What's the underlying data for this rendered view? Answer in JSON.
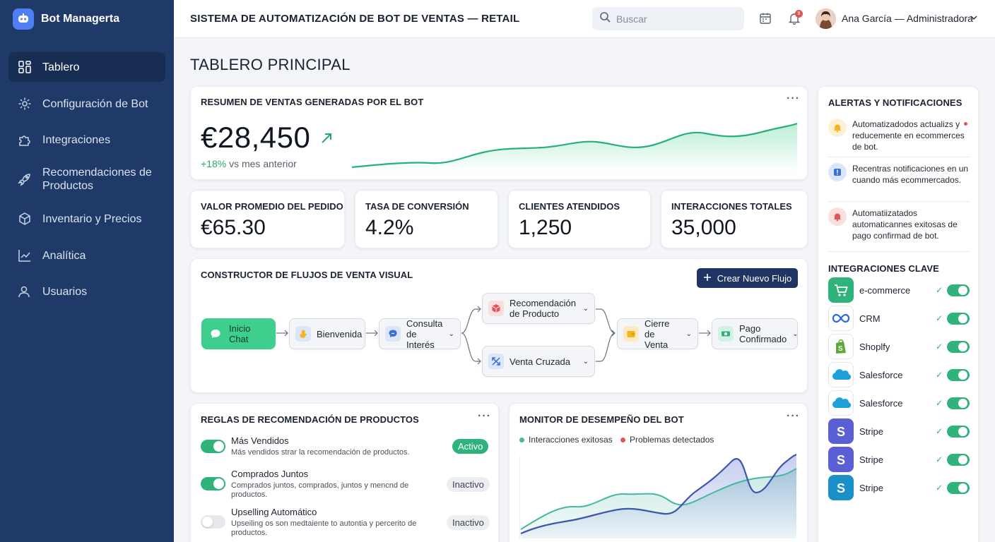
{
  "app": {
    "name": "Bot Managerta"
  },
  "sidebar": {
    "items": [
      {
        "label": "Tablero",
        "icon": "dashboard-grid-icon",
        "active": true
      },
      {
        "label": "Configuración de Bot",
        "icon": "gear-icon"
      },
      {
        "label": "Integraciones",
        "icon": "puzzle-icon"
      },
      {
        "label": "Recomendaciones de Productos",
        "icon": "rocket-icon"
      },
      {
        "label": "Inventario y Precios",
        "icon": "box-icon"
      },
      {
        "label": "Analítica",
        "icon": "line-chart-icon"
      },
      {
        "label": "Usuarios",
        "icon": "users-icon"
      }
    ]
  },
  "header": {
    "title": "SISTEMA DE AUTOMATIZACIÓN DE BOT DE VENTAS — RETAIL",
    "search_placeholder": "Buscar",
    "notification_count": "9",
    "user": "Ana García — Administradora"
  },
  "page": {
    "title": "TABLERO PRINCIPAL"
  },
  "sales": {
    "title": "RESUMEN DE VENTAS GENERADAS POR EL BOT",
    "value": "€28,450",
    "delta_pct": "+18%",
    "delta_text": " vs mes anterior",
    "trend_color": "#27a86a"
  },
  "kpis": [
    {
      "label": "VALOR PROMEDIO DEL PEDIDO",
      "value": "€65.30"
    },
    {
      "label": "TASA DE CONVERSIÓN",
      "value": "4.2%"
    },
    {
      "label": "CLIENTES ATENDIDOS",
      "value": "1,250"
    },
    {
      "label": "INTERACCIONES TOTALES",
      "value": "35,000"
    }
  ],
  "flow": {
    "title": "CONSTRUCTOR DE FLUJOS DE VENTA VISUAL",
    "new_button": "Crear Nuevo Flujo",
    "nodes": [
      {
        "label": "Inicio Chat",
        "icon": "chat-bubble-icon"
      },
      {
        "label": "Bienvenida",
        "icon": "wave-hand-icon"
      },
      {
        "label": "Consulta de Interés",
        "icon": "question-bubble-icon"
      },
      {
        "label": "Recomendación de Producto",
        "icon": "product-box-icon"
      },
      {
        "label": "Venta Cruzada",
        "icon": "cross-arrows-icon"
      },
      {
        "label": "Cierre de Venta",
        "icon": "wallet-icon"
      },
      {
        "label": "Pago Confirmado",
        "icon": "money-icon"
      }
    ]
  },
  "rules": {
    "title": "REGLAS DE RECOMENDACIÓN DE PRODUCTOS",
    "items": [
      {
        "name": "Más Vendidos",
        "desc": "Más vendidos strar la recomendación de productos.",
        "status": "Activo",
        "on": true
      },
      {
        "name": "Comprados Juntos",
        "desc": "Comprados juntos, comprados, juntos y mencnd de productos.",
        "status": "Inactivo",
        "on": true
      },
      {
        "name": "Upselling Automático",
        "desc": "Upseiling os son medtaiente to autontia y percerito de productos.",
        "status": "Inactivo",
        "on": false
      }
    ]
  },
  "monitor": {
    "title": "MONITOR DE DESEMPEÑO DEL BOT",
    "legend": [
      {
        "label": "Interacciones exitosas",
        "color": "#45b8a0"
      },
      {
        "label": "Problemas detectados",
        "color": "#e25555"
      }
    ]
  },
  "alerts": {
    "title": "ALERTAS Y NOTIFICACIONES",
    "items": [
      {
        "text": "Automatizadodos actualizs y reducemente en ecommerces de bot.",
        "icon": "bell-icon",
        "color": "#f4b41a"
      },
      {
        "text": "Recentras notificaciones en un cuando más ecommercados.",
        "icon": "info-icon",
        "color": "#3a6fd8"
      },
      {
        "text": "Automatiizatados automaticannes exitosas de pago confirmad de bot.",
        "icon": "bell-alert-icon",
        "color": "#e25555"
      }
    ]
  },
  "integrations": {
    "title": "INTEGRACIONES CLAVE",
    "items": [
      {
        "name": "e-commerce",
        "icon": "cart-icon",
        "color": "#2fb37b"
      },
      {
        "name": "CRM",
        "icon": "infinity-icon",
        "color": "#2d6bd6"
      },
      {
        "name": "Shoplfy",
        "icon": "shopify-bag-icon",
        "color": "#5fa83a"
      },
      {
        "name": "Salesforce",
        "icon": "salesforce-cloud-icon",
        "color": "#1ea0db"
      },
      {
        "name": "Salesforce",
        "icon": "salesforce-cloud-icon",
        "color": "#1ea0db"
      },
      {
        "name": "Stripe",
        "icon": "stripe-s-icon",
        "color": "#5b5fd6"
      },
      {
        "name": "Stripe",
        "icon": "stripe-s-icon",
        "color": "#5b5fd6"
      },
      {
        "name": "Stripe",
        "icon": "stripe-s-icon",
        "color": "#1a8fc8"
      }
    ]
  }
}
